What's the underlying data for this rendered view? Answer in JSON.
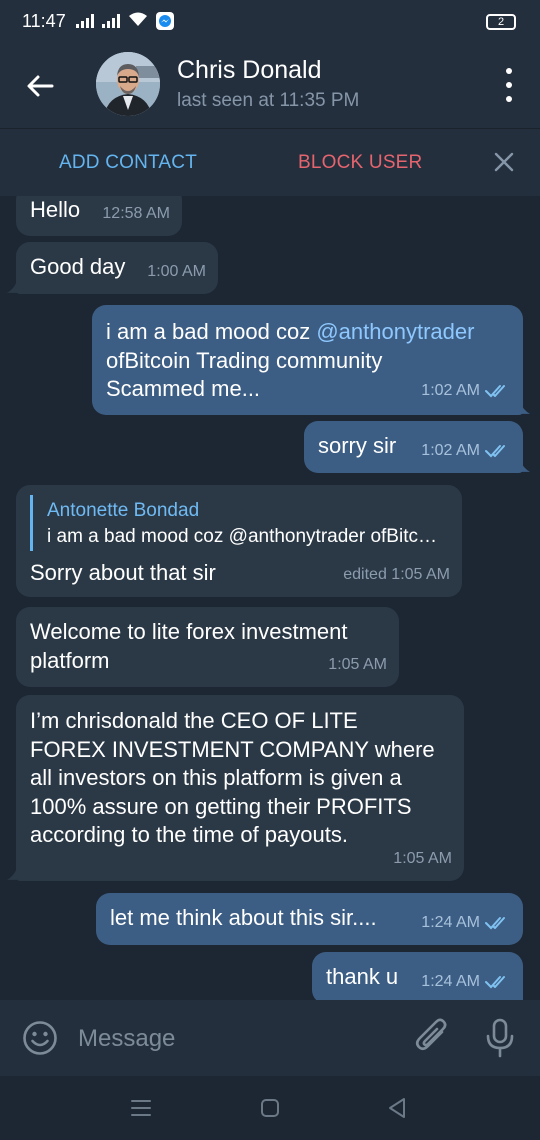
{
  "status_bar": {
    "time": "11:47",
    "battery": "2"
  },
  "header": {
    "name": "Chris Donald",
    "last_seen": "last seen at 11:35 PM"
  },
  "action_bar": {
    "add_contact": "ADD CONTACT",
    "block_user": "BLOCK USER"
  },
  "messages": [
    {
      "dir": "in",
      "text": "Hello",
      "time": "12:58 AM"
    },
    {
      "dir": "in",
      "text": "Good day",
      "time": "1:00 AM"
    },
    {
      "dir": "out",
      "line1_pre": "i am a bad mood coz ",
      "mention": "@anthonytrader",
      "line2": "ofBitcoin Trading community",
      "line3": "Scammed me...",
      "time": "1:02 AM"
    },
    {
      "dir": "out",
      "text": "sorry sir",
      "time": "1:02 AM"
    },
    {
      "dir": "in",
      "reply_name": "Antonette Bondad",
      "reply_text": "i am a bad mood coz @anthonytrader ofBitcoin Trading community Scammed me...",
      "text": "Sorry about that sir",
      "time": "edited 1:05 AM"
    },
    {
      "dir": "in",
      "line1": "Welcome to lite forex investment",
      "line2": "platform",
      "time": "1:05 AM"
    },
    {
      "dir": "in",
      "lines": [
        "I’m chrisdonald the CEO OF LITE",
        "FOREX INVESTMENT COMPANY where",
        "all investors on this platform is given a",
        "100% assure on getting their PROFITS",
        "according to the time of payouts."
      ],
      "time": "1:05 AM"
    },
    {
      "dir": "out",
      "text": "let me think about this sir....",
      "time": "1:24 AM"
    },
    {
      "dir": "out",
      "text": "thank u",
      "time": "1:24 AM"
    }
  ],
  "input": {
    "placeholder": "Message"
  },
  "colors": {
    "background": "#1d2733",
    "header": "#242f3d",
    "incoming_bubble": "#2b3947",
    "outgoing_bubble": "#3d5e84",
    "accent_blue": "#64b5ef",
    "block_red": "#e5646e"
  }
}
